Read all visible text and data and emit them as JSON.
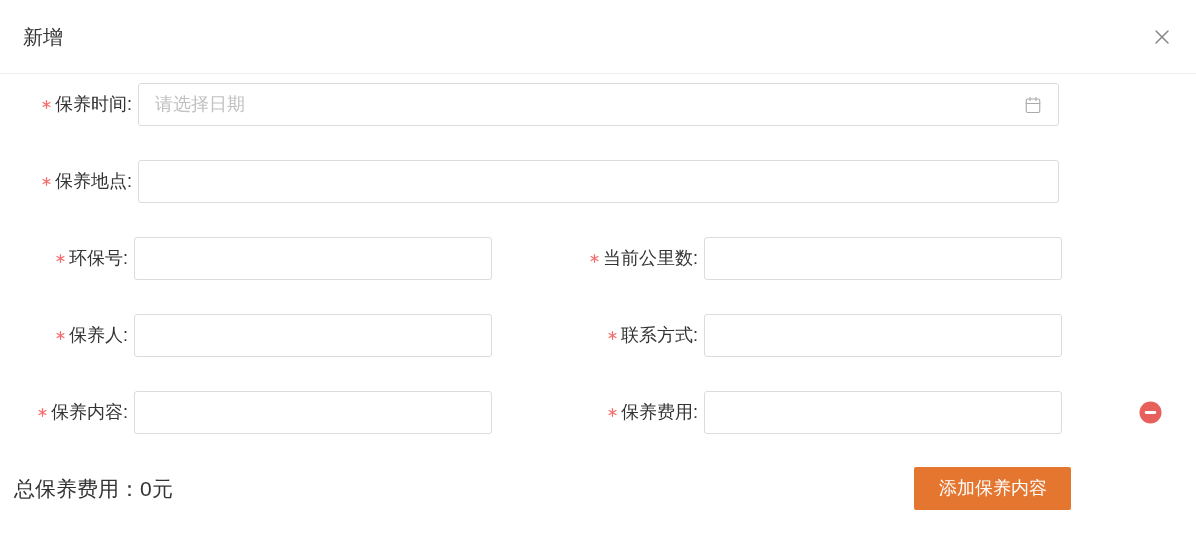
{
  "dialog": {
    "title": "新增"
  },
  "full_rows": [
    {
      "label": "保养时间:",
      "required": true,
      "placeholder": "请选择日期",
      "kind": "date"
    },
    {
      "label": "保养地点:",
      "required": true,
      "kind": "text"
    }
  ],
  "half_rows": [
    [
      {
        "label": "环保号:",
        "required": true
      },
      {
        "label": "当前公里数:",
        "required": true
      }
    ],
    [
      {
        "label": "保养人:",
        "required": true
      },
      {
        "label": "联系方式:",
        "required": true
      }
    ],
    [
      {
        "label": "保养内容:",
        "required": true
      },
      {
        "label": "保养费用:",
        "required": true
      }
    ]
  ],
  "total": "总保养费用：0元",
  "add_button": "添加保养内容"
}
